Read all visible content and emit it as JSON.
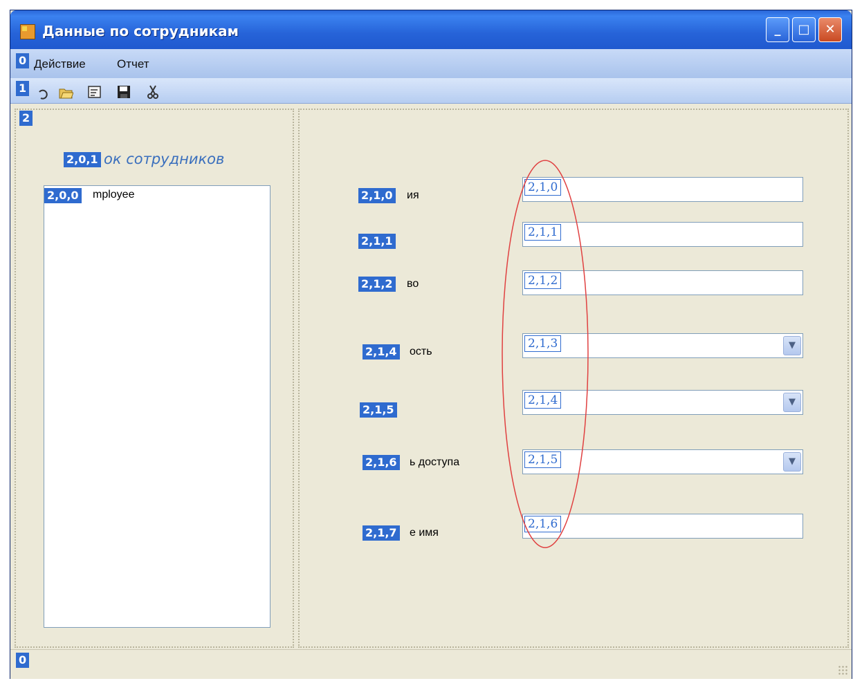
{
  "window": {
    "title": "Данные по сотрудникам",
    "controls": [
      "_",
      "□",
      "✕"
    ]
  },
  "menu": {
    "badge": "0",
    "items": [
      "Действие",
      "Отчет"
    ]
  },
  "toolbar": {
    "badge": "1",
    "icons": [
      "undo-icon",
      "open-folder-icon",
      "edit-icon",
      "save-icon",
      "cut-icon"
    ]
  },
  "panel": {
    "badge": "2",
    "list": {
      "title_badge": "2,0,1",
      "title": "ок сотрудников",
      "box_badge": "2,0,0",
      "item": "mployee"
    },
    "labels": [
      {
        "badge": "2,1,0",
        "text": "ия"
      },
      {
        "badge": "2,1,1",
        "text": ""
      },
      {
        "badge": "2,1,2",
        "text": "во"
      },
      {
        "badge": "2,1,4",
        "text": "ость"
      },
      {
        "badge": "2,1,5",
        "text": ""
      },
      {
        "badge": "2,1,6",
        "text": "ь доступа"
      },
      {
        "badge": "2,1,7",
        "text": "е имя"
      }
    ],
    "fields": [
      {
        "badge": "2,1,0",
        "type": "text"
      },
      {
        "badge": "2,1,1",
        "type": "text"
      },
      {
        "badge": "2,1,2",
        "type": "text"
      },
      {
        "badge": "2,1,3",
        "type": "combo"
      },
      {
        "badge": "2,1,4",
        "type": "combo"
      },
      {
        "badge": "2,1,5",
        "type": "combo"
      },
      {
        "badge": "2,1,6",
        "type": "text"
      }
    ]
  },
  "status": {
    "badge": "0"
  },
  "colors": {
    "badge": "#2f6bcf",
    "oval": "#e04040",
    "panel_bg": "#ece9d8"
  }
}
